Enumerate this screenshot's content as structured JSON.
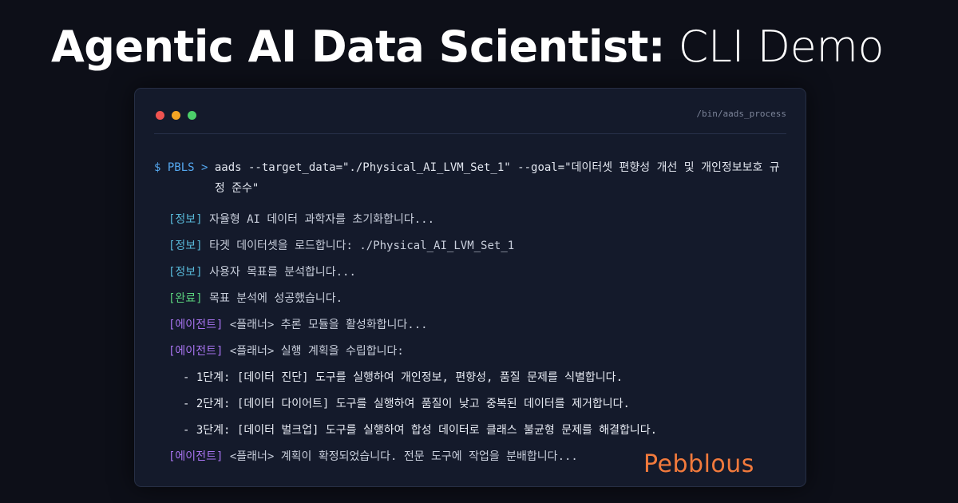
{
  "heading": {
    "bold": "Agentic AI Data Scientist:",
    "light": "CLI Demo"
  },
  "terminal": {
    "path": "/bin/aads_process",
    "prompt": "$ PBLS > ",
    "command": "aads --target_data=\"./Physical_AI_LVM_Set_1\" --goal=\"데이터셋 편향성 개선 및 개인정보보호 규정 준수\"",
    "lines": [
      {
        "tag": "[정보]",
        "text": "자율형 AI 데이터 과학자를 초기화합니다..."
      },
      {
        "tag": "[정보]",
        "text": "타겟 데이터셋을 로드합니다: ./Physical_AI_LVM_Set_1"
      },
      {
        "tag": "[정보]",
        "text": "사용자 목표를 분석합니다..."
      },
      {
        "tag": "[완료]",
        "text": "목표 분석에 성공했습니다."
      },
      {
        "tag": "[에이전트]",
        "text": "<플래너> 추론 모듈을 활성화합니다..."
      },
      {
        "tag": "[에이전트]",
        "text": "<플래너> 실행 계획을 수립합니다:"
      },
      {
        "text": "- 1단계: [데이터 진단] 도구를 실행하여 개인정보, 편향성, 품질 문제를 식별합니다."
      },
      {
        "text": "- 2단계: [데이터 다이어트] 도구를 실행하여 품질이 낮고 중복된 데이터를 제거합니다."
      },
      {
        "text": "- 3단계: [데이터 벌크업] 도구를 실행하여 합성 데이터로 클래스 불균형 문제를 해결합니다."
      },
      {
        "tag": "[에이전트]",
        "text": "<플래너> 계획이 확정되었습니다. 전문 도구에 작업을 분배합니다..."
      }
    ]
  },
  "brand": {
    "logo_text": "Pebblous"
  },
  "colors": {
    "background": "#0d0f18",
    "terminal_bg": "#141a2b",
    "prompt": "#55a8f0",
    "info_tag": "#58b8d8",
    "done_tag": "#5ad17d",
    "agent_tag": "#a874f0",
    "logo": "#f27a3c"
  }
}
